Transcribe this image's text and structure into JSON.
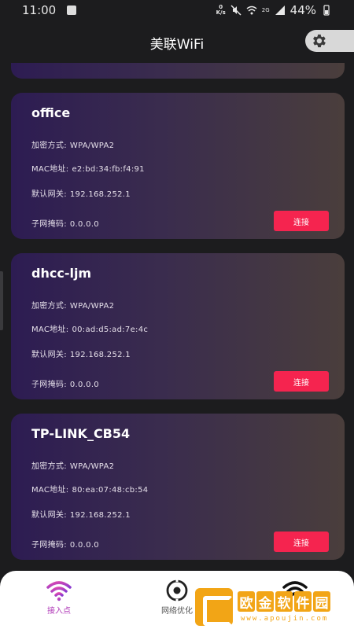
{
  "status_bar": {
    "time": "11:00",
    "speed_value": "0",
    "speed_unit": "K/s",
    "network": "2G",
    "battery": "44%"
  },
  "app_bar": {
    "title": "美联WiFi",
    "settings_icon": "gear-icon"
  },
  "networks": [
    {
      "ssid": "office",
      "encryption_label": "加密方式:",
      "encryption": "WPA/WPA2",
      "mac_label": "MAC地址:",
      "mac": "e2:bd:34:fb:f4:91",
      "gateway_label": "默认网关:",
      "gateway": "192.168.252.1",
      "subnet_label": "子网掩码:",
      "subnet": "0.0.0.0",
      "connect_label": "连接"
    },
    {
      "ssid": "dhcc-ljm",
      "encryption_label": "加密方式:",
      "encryption": "WPA/WPA2",
      "mac_label": "MAC地址:",
      "mac": "00:ad:d5:ad:7e:4c",
      "gateway_label": "默认网关:",
      "gateway": "192.168.252.1",
      "subnet_label": "子网掩码:",
      "subnet": "0.0.0.0",
      "connect_label": "连接"
    },
    {
      "ssid": "TP-LINK_CB54",
      "encryption_label": "加密方式:",
      "encryption": "WPA/WPA2",
      "mac_label": "MAC地址:",
      "mac": "80:ea:07:48:cb:54",
      "gateway_label": "默认网关:",
      "gateway": "192.168.252.1",
      "subnet_label": "子网掩码:",
      "subnet": "0.0.0.0",
      "connect_label": "连接"
    }
  ],
  "bottom_nav": {
    "items": [
      {
        "label": "接入点",
        "icon": "wifi-icon",
        "active": true
      },
      {
        "label": "网络优化",
        "icon": "target-icon",
        "active": false
      },
      {
        "label": "",
        "icon": "wifi-signal-icon",
        "active": false
      }
    ]
  },
  "watermark": {
    "chars": [
      "欧",
      "金",
      "软",
      "件",
      "园"
    ],
    "url": "www.apoujin.com"
  },
  "colors": {
    "background": "#1c1c1e",
    "card_gradient_start": "#2d1c52",
    "card_gradient_end": "#4a3e3c",
    "connect_button": "#f5244f",
    "nav_active": "#b03ab8",
    "watermark": "#f2a516"
  }
}
